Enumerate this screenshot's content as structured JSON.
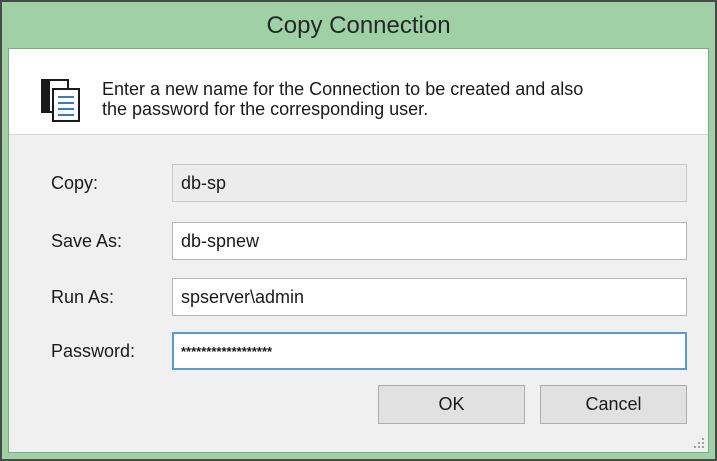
{
  "window": {
    "title": "Copy Connection"
  },
  "banner": {
    "icon": "document-copy-icon",
    "line1": "Enter a new name for the Connection to be created and also",
    "line2": "the password for the corresponding user."
  },
  "form": {
    "copy_label": "Copy:",
    "copy_value": "db-sp",
    "save_as_label": "Save As:",
    "save_as_value": "db-spnew",
    "run_as_label": "Run As:",
    "run_as_value": "spserver\\admin",
    "password_label": "Password:",
    "password_value": "******************"
  },
  "buttons": {
    "ok_label": "OK",
    "cancel_label": "Cancel"
  },
  "colors": {
    "title_bar": "#9fd0a6",
    "focus_border": "#5b9bd5"
  }
}
